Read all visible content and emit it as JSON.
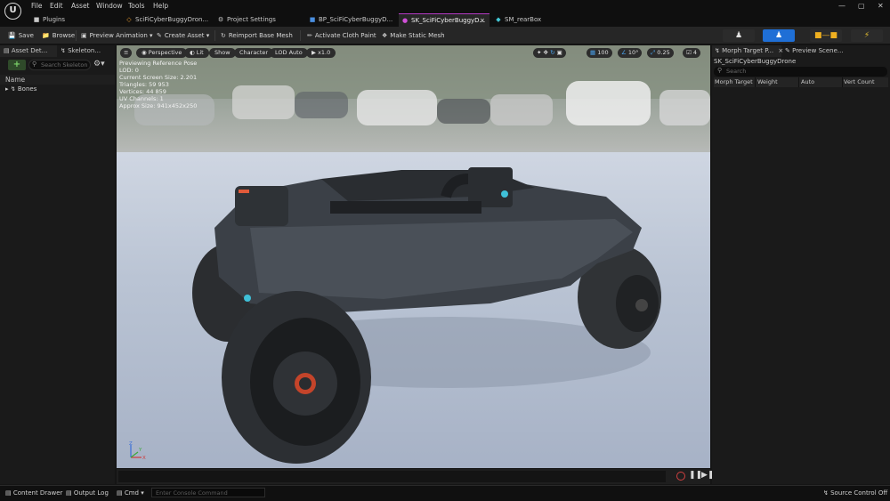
{
  "menu": [
    "File",
    "Edit",
    "Asset",
    "Window",
    "Tools",
    "Help"
  ],
  "logo_text": "U",
  "window_controls": [
    "—",
    "▢",
    "✕"
  ],
  "tabs": [
    {
      "label": "Plugins",
      "icon": "plugin-icon"
    },
    {
      "label": "SciFiCyberBuggyDron...",
      "icon": "blueprint-icon"
    },
    {
      "label": "Project Settings",
      "icon": "settings-icon"
    },
    {
      "label": "BP_SciFiCyberBuggyD...",
      "icon": "blueprint-icon"
    },
    {
      "label": "SK_SciFiCyberBuggyD...",
      "icon": "skeletal-mesh-icon"
    },
    {
      "label": "SM_rearBox",
      "icon": "static-mesh-icon"
    }
  ],
  "tab_close_glyph": "×",
  "toolbar": {
    "save": "Save",
    "browse": "Browse",
    "preview_animation": "Preview Animation",
    "create_asset": "Create Asset",
    "reimport": "Reimport Base Mesh",
    "cloth_paint": "Activate Cloth Paint",
    "static_mesh": "Make Static Mesh",
    "dropdown_glyph": "▾"
  },
  "mode_buttons": [
    {
      "name": "skeleton",
      "color": "#2b2b2b"
    },
    {
      "name": "skeletal-mesh",
      "color": "#1f6fd6"
    },
    {
      "name": "animation",
      "color": "#2b2b2b"
    },
    {
      "name": "physics",
      "color": "#2b2b2b"
    }
  ],
  "left_panel": {
    "tab1": "Asset Det...",
    "tab2": "Skeleton...",
    "search_placeholder": "Search Skeleton",
    "add_glyph": "+",
    "name_header": "Name",
    "tree_root": "Bones"
  },
  "viewport": {
    "menu_glyph": "≡",
    "perspective": "Perspective",
    "lit": "Lit",
    "show": "Show",
    "character": "Character",
    "lod": "LOD Auto",
    "speed": "x1.0",
    "grid_snap": "100",
    "rot_snap": "10°",
    "scale_snap": "0.25",
    "camera_speed": "4",
    "stats": [
      "Previewing Reference Pose",
      "LOD: 0",
      "Current Screen Size: 2.201",
      "Triangles: 59 953",
      "Vertices: 44 859",
      "UV Channels: 1",
      "Approx Size: 941x452x250"
    ],
    "axis_z": "Z",
    "axis_x": "X",
    "axis_y": "Y"
  },
  "right_panel": {
    "tab1": "Morph Target P...",
    "tab2": "Preview Scene...",
    "asset_name": "SK_SciFiCyberBuggyDrone",
    "search_placeholder": "Search",
    "columns": [
      "Morph Target",
      "Weight",
      "Auto",
      "Vert Count"
    ]
  },
  "status": {
    "content_drawer": "Content Drawer",
    "output_log": "Output Log",
    "cmd": "Cmd",
    "console_placeholder": "Enter Console Command",
    "source_control": "Source Control Off"
  }
}
